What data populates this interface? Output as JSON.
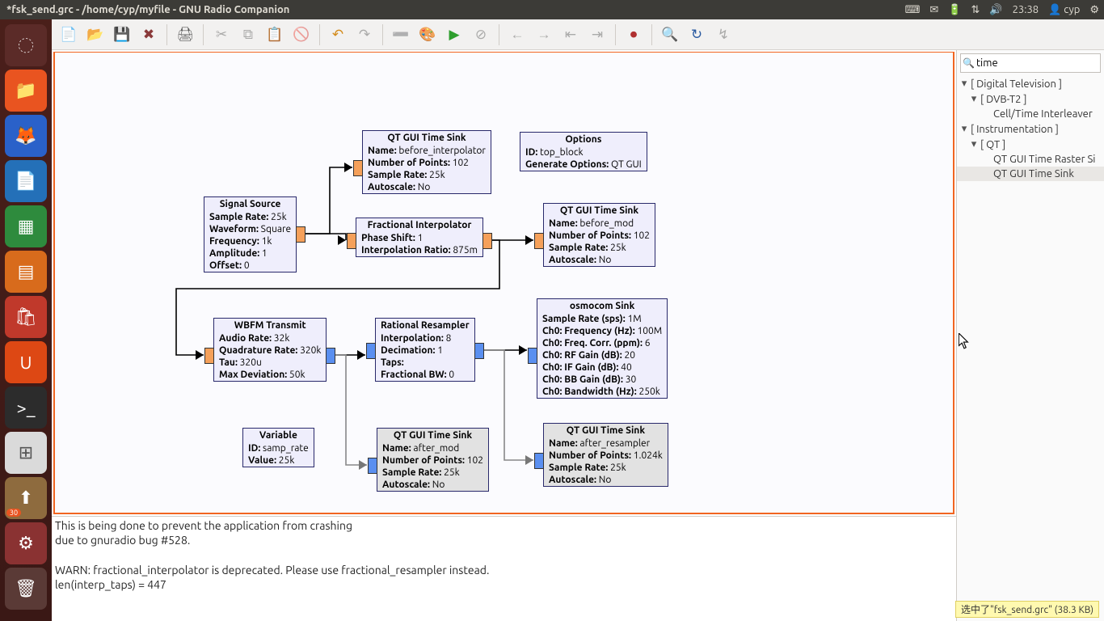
{
  "panel": {
    "title": "*fsk_send.grc - /home/cyp/myfile - GNU Radio Companion",
    "time": "23:38",
    "user": "cyp"
  },
  "launcher": {
    "badge": "30",
    "items": [
      {
        "name": "dash",
        "bg": "#5b2b28",
        "glyph": "◌"
      },
      {
        "name": "files",
        "bg": "#e95420",
        "glyph": "📁"
      },
      {
        "name": "firefox",
        "bg": "#2a61c9",
        "glyph": "🦊"
      },
      {
        "name": "writer",
        "bg": "#2470b8",
        "glyph": "📄"
      },
      {
        "name": "calc",
        "bg": "#2e8b3d",
        "glyph": "▦"
      },
      {
        "name": "impress",
        "bg": "#d86b1c",
        "glyph": "▤"
      },
      {
        "name": "software",
        "bg": "#c0392b",
        "glyph": "🛍"
      },
      {
        "name": "ubuntuone",
        "bg": "#dd4814",
        "glyph": "U"
      },
      {
        "name": "terminal",
        "bg": "#2c2c2c",
        "glyph": ">_"
      },
      {
        "name": "grc",
        "bg": "#dadada",
        "glyph": "⊞",
        "fg": "#555"
      },
      {
        "name": "updates",
        "bg": "#8e6b3e",
        "glyph": "⬆"
      },
      {
        "name": "settings",
        "bg": "#8a3232",
        "glyph": "⚙"
      },
      {
        "name": "trash",
        "bg": "#5a3a36",
        "glyph": "🗑"
      }
    ]
  },
  "search": {
    "query": "time"
  },
  "tree": {
    "items": [
      {
        "label": "[ Digital Television ]",
        "lvl": 0,
        "tw": "▾"
      },
      {
        "label": "[ DVB-T2 ]",
        "lvl": 1,
        "tw": "▾"
      },
      {
        "label": "Cell/Time Interleaver",
        "lvl": 2,
        "tw": ""
      },
      {
        "label": "[ Instrumentation ]",
        "lvl": 0,
        "tw": "▾"
      },
      {
        "label": "[ QT ]",
        "lvl": 1,
        "tw": "▾"
      },
      {
        "label": "QT GUI Time Raster Si",
        "lvl": 2,
        "tw": ""
      },
      {
        "label": "QT GUI Time Sink",
        "lvl": 2,
        "tw": "",
        "sel": true
      }
    ]
  },
  "console": {
    "lines": [
      "This is being done to prevent the application from crashing",
      "due to gnuradio bug #528.",
      "",
      "WARN: fractional_interpolator is deprecated. Please use fractional_resampler instead.",
      "len(interp_taps) = 447"
    ]
  },
  "status_tip": "选中了\"fsk_send.grc\" (38.3 KB)",
  "blocks": {
    "options": {
      "title": "Options",
      "rows": [
        [
          "ID:",
          "top_block"
        ],
        [
          "Generate Options:",
          "QT GUI"
        ]
      ]
    },
    "sig": {
      "title": "Signal Source",
      "rows": [
        [
          "Sample Rate:",
          "25k"
        ],
        [
          "Waveform:",
          "Square"
        ],
        [
          "Frequency:",
          "1k"
        ],
        [
          "Amplitude:",
          "1"
        ],
        [
          "Offset:",
          "0"
        ]
      ]
    },
    "tsink1": {
      "title": "QT GUI Time Sink",
      "rows": [
        [
          "Name:",
          "before_interpolator"
        ],
        [
          "Number of Points:",
          "102"
        ],
        [
          "Sample Rate:",
          "25k"
        ],
        [
          "Autoscale:",
          "No"
        ]
      ]
    },
    "interp": {
      "title": "Fractional Interpolator",
      "rows": [
        [
          "Phase Shift:",
          "1"
        ],
        [
          "Interpolation Ratio:",
          "875m"
        ]
      ]
    },
    "tsink2": {
      "title": "QT GUI Time Sink",
      "rows": [
        [
          "Name:",
          "before_mod"
        ],
        [
          "Number of Points:",
          "102"
        ],
        [
          "Sample Rate:",
          "25k"
        ],
        [
          "Autoscale:",
          "No"
        ]
      ]
    },
    "wbfm": {
      "title": "WBFM Transmit",
      "rows": [
        [
          "Audio Rate:",
          "32k"
        ],
        [
          "Quadrature Rate:",
          "320k"
        ],
        [
          "Tau:",
          "320u"
        ],
        [
          "Max Deviation:",
          "50k"
        ]
      ]
    },
    "resamp": {
      "title": "Rational Resampler",
      "rows": [
        [
          "Interpolation:",
          "8"
        ],
        [
          "Decimation:",
          "1"
        ],
        [
          "Taps:",
          ""
        ],
        [
          "Fractional BW:",
          "0"
        ]
      ]
    },
    "osmo": {
      "title": "osmocom Sink",
      "rows": [
        [
          "Sample Rate (sps):",
          "1M"
        ],
        [
          "Ch0: Frequency (Hz):",
          "100M"
        ],
        [
          "Ch0: Freq. Corr. (ppm):",
          "6"
        ],
        [
          "Ch0: RF Gain (dB):",
          "20"
        ],
        [
          "Ch0: IF Gain (dB):",
          "40"
        ],
        [
          "Ch0: BB Gain (dB):",
          "30"
        ],
        [
          "Ch0: Bandwidth (Hz):",
          "250k"
        ]
      ]
    },
    "tsink3": {
      "title": "QT GUI Time Sink",
      "rows": [
        [
          "Name:",
          "after_mod"
        ],
        [
          "Number of Points:",
          "102"
        ],
        [
          "Sample Rate:",
          "25k"
        ],
        [
          "Autoscale:",
          "No"
        ]
      ]
    },
    "tsink4": {
      "title": "QT GUI Time Sink",
      "rows": [
        [
          "Name:",
          "after_resampler"
        ],
        [
          "Number of Points:",
          "1.024k"
        ],
        [
          "Sample Rate:",
          "25k"
        ],
        [
          "Autoscale:",
          "No"
        ]
      ]
    },
    "var": {
      "title": "Variable",
      "rows": [
        [
          "ID:",
          "samp_rate"
        ],
        [
          "Value:",
          "25k"
        ]
      ]
    }
  }
}
